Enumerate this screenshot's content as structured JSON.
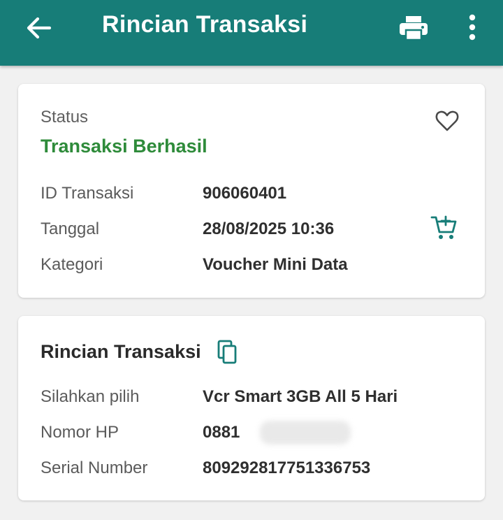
{
  "appbar": {
    "title": "Rincian Transaksi",
    "back_icon": "arrow-left-icon",
    "print_icon": "printer-icon",
    "more_icon": "more-vertical-icon",
    "color": "#177d78"
  },
  "status_card": {
    "status_label": "Status",
    "status_value": "Transaksi Berhasil",
    "status_color": "#2e8b3a",
    "favorite_icon": "heart-outline-icon",
    "reorder_icon": "cart-plus-icon",
    "rows": [
      {
        "label": "ID Transaksi",
        "value": "906060401"
      },
      {
        "label": "Tanggal",
        "value": "28/08/2025 10:36"
      },
      {
        "label": "Kategori",
        "value": "Voucher Mini Data"
      }
    ]
  },
  "detail_card": {
    "title": "Rincian Transaksi",
    "copy_icon": "copy-icon",
    "rows": [
      {
        "label": "Silahkan pilih",
        "value": "Vcr Smart 3GB All 5 Hari"
      },
      {
        "label": "Nomor HP",
        "value": "0881"
      },
      {
        "label": "Serial Number",
        "value": "809292817751336753"
      }
    ]
  }
}
